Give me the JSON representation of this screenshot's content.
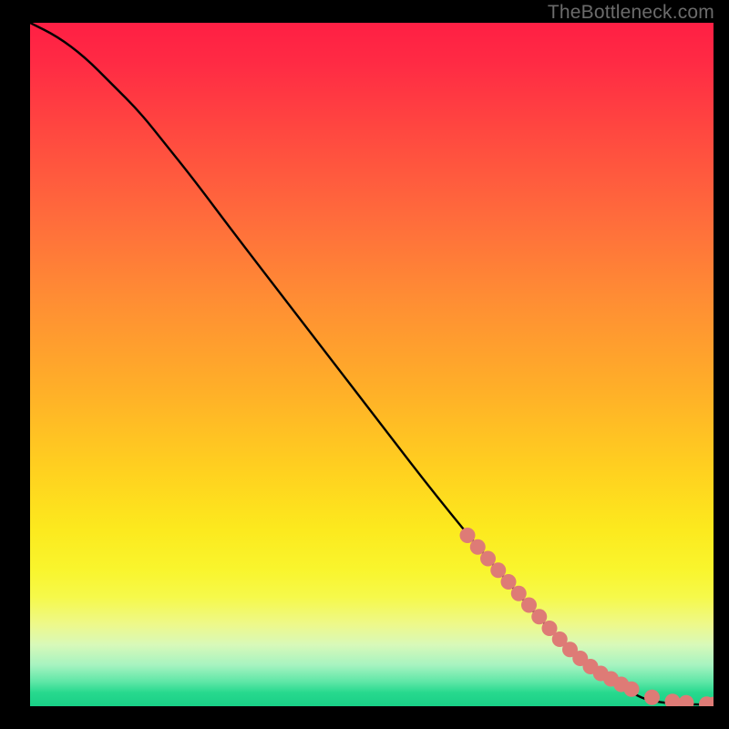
{
  "watermark": "TheBottleneck.com",
  "colors": {
    "curve": "#000000",
    "marker_fill": "#de7b76",
    "marker_stroke": "#a24f4b",
    "background_black": "#000000"
  },
  "chart_data": {
    "type": "line",
    "title": "",
    "xlabel": "",
    "ylabel": "",
    "xlim": [
      0,
      100
    ],
    "ylim": [
      0,
      100
    ],
    "grid": false,
    "curve": {
      "name": "bottleneck-curve",
      "x": [
        0,
        4,
        8,
        12,
        16,
        20,
        24,
        30,
        40,
        50,
        60,
        70,
        78,
        84,
        88,
        90,
        92,
        94,
        96,
        98,
        100
      ],
      "y": [
        100,
        98,
        95,
        91,
        87,
        82,
        77,
        69,
        56,
        43,
        30,
        18,
        9,
        4,
        2,
        1,
        0.6,
        0.4,
        0.3,
        0.25,
        0.2
      ]
    },
    "markers": {
      "name": "highlighted-points",
      "x": [
        64,
        65.5,
        67,
        68.5,
        70,
        71.5,
        73,
        74.5,
        76,
        77.5,
        79,
        80.5,
        82,
        83.5,
        85,
        86.5,
        88,
        91,
        94,
        96,
        99,
        100
      ],
      "y": [
        25,
        23.3,
        21.6,
        19.9,
        18.2,
        16.5,
        14.8,
        13.1,
        11.4,
        9.8,
        8.3,
        7.0,
        5.8,
        4.8,
        4.0,
        3.2,
        2.5,
        1.3,
        0.7,
        0.5,
        0.3,
        0.25
      ]
    }
  }
}
